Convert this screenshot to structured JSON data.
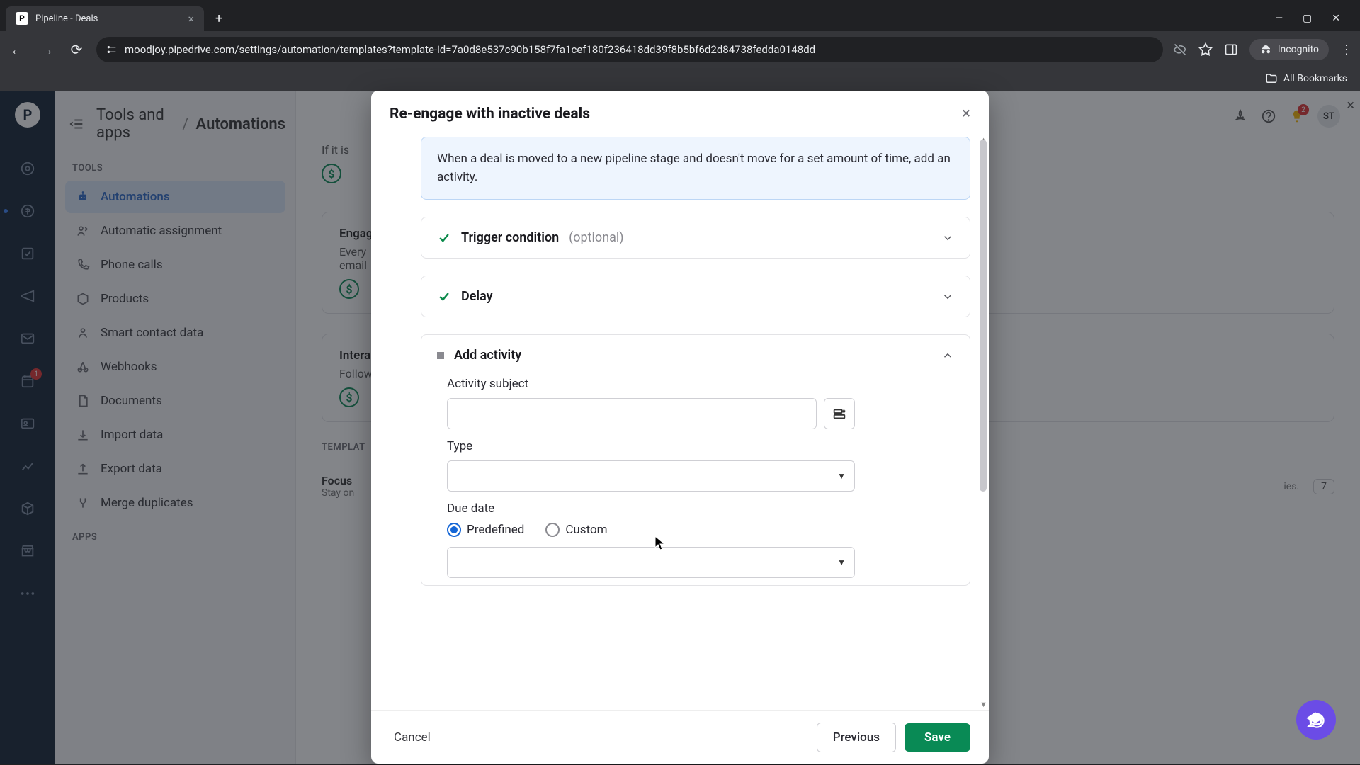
{
  "browser": {
    "tab_title": "Pipeline - Deals",
    "url": "moodjoy.pipedrive.com/settings/automation/templates?template-id=7a0d8e537c90b158f7fa1cef180f236418dd39f8b5bf6d2d84738fedda0148dd",
    "incognito_label": "Incognito",
    "all_bookmarks": "All Bookmarks"
  },
  "breadcrumb": {
    "root": "Tools and apps",
    "current": "Automations"
  },
  "sidebar": {
    "section_tools": "TOOLS",
    "section_apps": "APPS",
    "items": [
      {
        "label": "Automations",
        "active": true
      },
      {
        "label": "Automatic assignment"
      },
      {
        "label": "Phone calls"
      },
      {
        "label": "Products"
      },
      {
        "label": "Smart contact data"
      },
      {
        "label": "Webhooks"
      },
      {
        "label": "Documents"
      },
      {
        "label": "Import data"
      },
      {
        "label": "Export data"
      },
      {
        "label": "Merge duplicates"
      }
    ]
  },
  "top_right": {
    "avatar": "ST",
    "bulb_badge": "2"
  },
  "rail_badge": "1",
  "background": {
    "partial_text_1": "If it is",
    "card2_title": "Engag",
    "card2_line1": "Every",
    "card2_line2": "email",
    "card3_title": "Intera",
    "card3_line1": "Follow",
    "templates_label": "TEMPLAT",
    "card4_title": "Focus",
    "card4_line1": "Stay on",
    "right_text_tail": "ies.",
    "count": "7"
  },
  "modal": {
    "title": "Re-engage with inactive deals",
    "info": "When a deal is moved to a new pipeline stage and doesn't move for a set amount of time, add an activity.",
    "step1_label": "Trigger condition",
    "step1_optional": "(optional)",
    "step2_label": "Delay",
    "step3_label": "Add activity",
    "field_subject": "Activity subject",
    "field_type": "Type",
    "field_due": "Due date",
    "radio_predefined": "Predefined",
    "radio_custom": "Custom",
    "btn_cancel": "Cancel",
    "btn_previous": "Previous",
    "btn_save": "Save"
  }
}
